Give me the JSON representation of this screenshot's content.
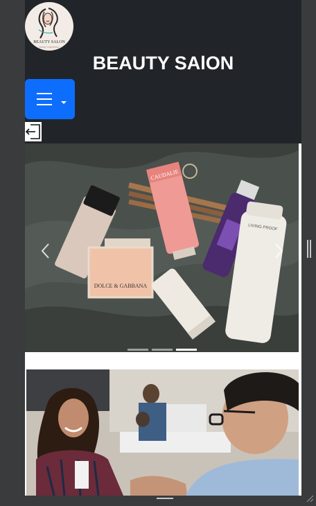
{
  "header": {
    "logo_text": "BEAUTY SALON",
    "logo_tagline": "beauty experience",
    "title": "BEAUTY SAlON"
  },
  "menu_button": {
    "icon": "hamburger-icon",
    "dropdown_icon": "caret-down-icon"
  },
  "logout": {
    "icon": "logout-icon"
  },
  "carousel": {
    "slide_count": 3,
    "active_index": 2,
    "slide_products": [
      "CAUDALIE",
      "DOLCE & GABBANA",
      "LIVING PROOF"
    ],
    "prev_icon": "chevron-left-icon",
    "next_icon": "chevron-right-icon"
  },
  "colors": {
    "navbar": "#212529",
    "menu_button": "#0d6efd",
    "page_background": "#ffffff",
    "frame": "#3a3b3d"
  }
}
